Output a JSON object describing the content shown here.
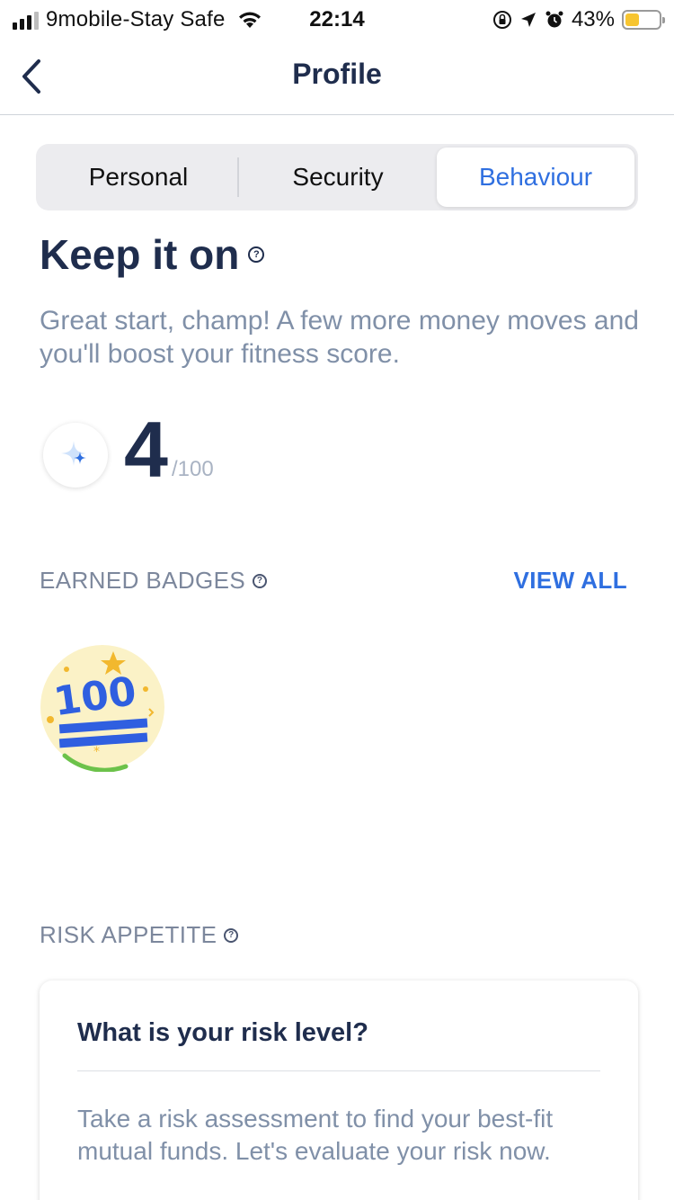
{
  "status_bar": {
    "carrier": "9mobile-Stay Safe",
    "time": "22:14",
    "battery_percent": "43%",
    "battery_level": 0.43,
    "signal_bars": 3
  },
  "nav": {
    "title": "Profile",
    "back_icon": "chevron-left-icon"
  },
  "tabs": [
    {
      "label": "Personal",
      "active": false
    },
    {
      "label": "Security",
      "active": false
    },
    {
      "label": "Behaviour",
      "active": true
    }
  ],
  "behaviour": {
    "title": "Keep it on",
    "subtitle": "Great start, champ! A few more money moves and you'll boost  your fitness score.",
    "score": "4",
    "score_max": "/100"
  },
  "badges_section": {
    "label": "EARNED BADGES",
    "view_all": "VIEW ALL"
  },
  "risk_section": {
    "label": "RISK APPETITE",
    "card_title": "What is your risk level?",
    "card_text": "Take a risk assessment to find your best-fit mutual funds. Let's evaluate your risk now."
  },
  "colors": {
    "accent": "#2f6fe0",
    "heading": "#1f2d4d",
    "muted": "#8090a8"
  }
}
